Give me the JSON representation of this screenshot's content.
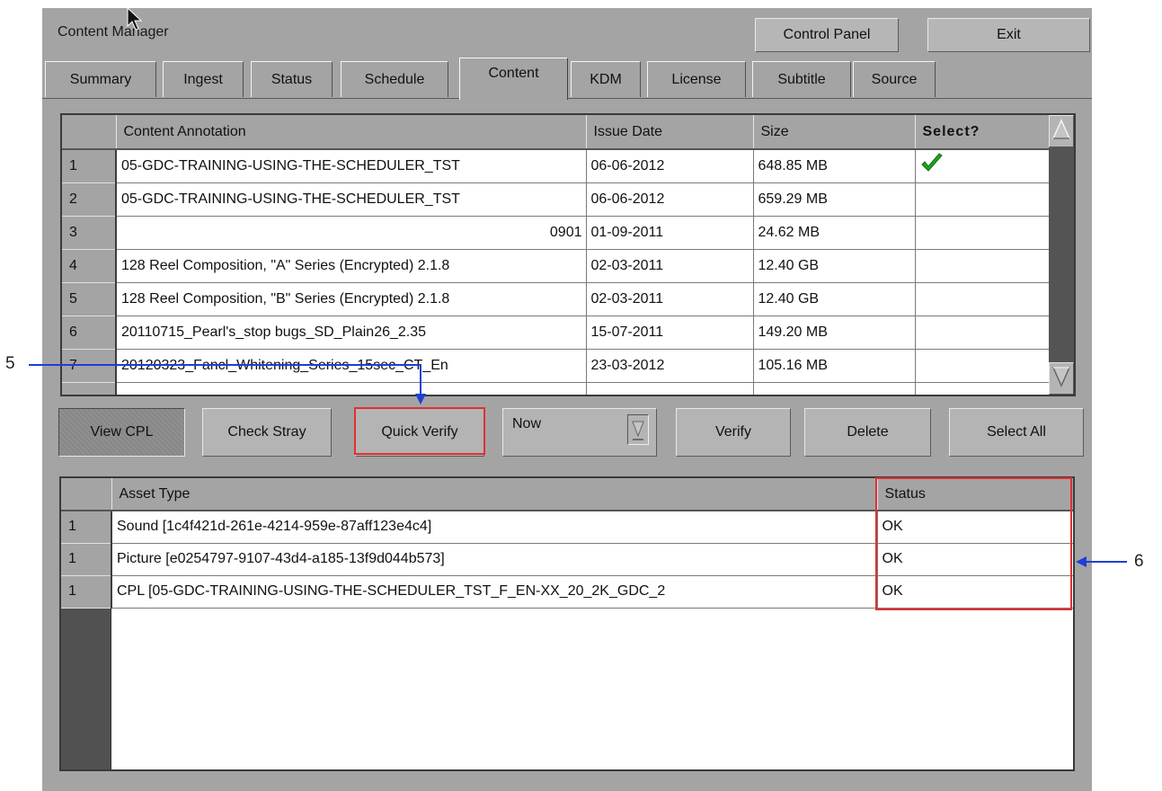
{
  "window": {
    "title": "Content Manager"
  },
  "top_buttons": {
    "control_panel": "Control Panel",
    "exit": "Exit"
  },
  "tabs": [
    "Summary",
    "Ingest",
    "Status",
    "Schedule",
    "Content",
    "KDM",
    "License",
    "Subtitle",
    "Source"
  ],
  "active_tab": "Content",
  "content_table": {
    "headers": [
      "Content Annotation",
      "Issue Date",
      "Size",
      "Select?"
    ],
    "rows": [
      {
        "num": "1",
        "annotation": "05-GDC-TRAINING-USING-THE-SCHEDULER_TST",
        "date": "06-06-2012",
        "size": "648.85 MB",
        "selected": true
      },
      {
        "num": "2",
        "annotation": "05-GDC-TRAINING-USING-THE-SCHEDULER_TST",
        "date": "06-06-2012",
        "size": "659.29 MB",
        "selected": false
      },
      {
        "num": "3",
        "annotation": "0901",
        "date": "01-09-2011",
        "size": "24.62 MB",
        "selected": false
      },
      {
        "num": "4",
        "annotation": "128 Reel Composition, \"A\" Series (Encrypted) 2.1.8",
        "date": "02-03-2011",
        "size": "12.40 GB",
        "selected": false
      },
      {
        "num": "5",
        "annotation": "128 Reel Composition, \"B\" Series (Encrypted) 2.1.8",
        "date": "02-03-2011",
        "size": "12.40 GB",
        "selected": false
      },
      {
        "num": "6",
        "annotation": "20110715_Pearl's_stop bugs_SD_Plain26_2.35",
        "date": "15-07-2011",
        "size": "149.20 MB",
        "selected": false
      },
      {
        "num": "7",
        "annotation": "20120323_Fancl_Whitening_Series_15sec_CT_En",
        "date": "23-03-2012",
        "size": "105.16 MB",
        "selected": false
      }
    ]
  },
  "buttons": {
    "view_cpl": "View CPL",
    "check_stray": "Check Stray",
    "quick_verify": "Quick Verify",
    "now": "Now",
    "verify": "Verify",
    "delete": "Delete",
    "select_all": "Select All"
  },
  "asset_table": {
    "headers": [
      "Asset Type",
      "Status"
    ],
    "rows": [
      {
        "num": "1",
        "type": "Sound [1c4f421d-261e-4214-959e-87aff123e4c4]",
        "status": "OK"
      },
      {
        "num": "1",
        "type": "Picture [e0254797-9107-43d4-a185-13f9d044b573]",
        "status": "OK"
      },
      {
        "num": "1",
        "type": "CPL [05-GDC-TRAINING-USING-THE-SCHEDULER_TST_F_EN-XX_20_2K_GDC_2",
        "status": "OK"
      }
    ]
  },
  "callouts": {
    "c5": "5",
    "c6": "6"
  },
  "colors": {
    "panel": "#a4a4a4",
    "highlight_box": "#e03030",
    "annotation_arrow": "#1f3fd4",
    "checkmark": "#1fa51f"
  }
}
